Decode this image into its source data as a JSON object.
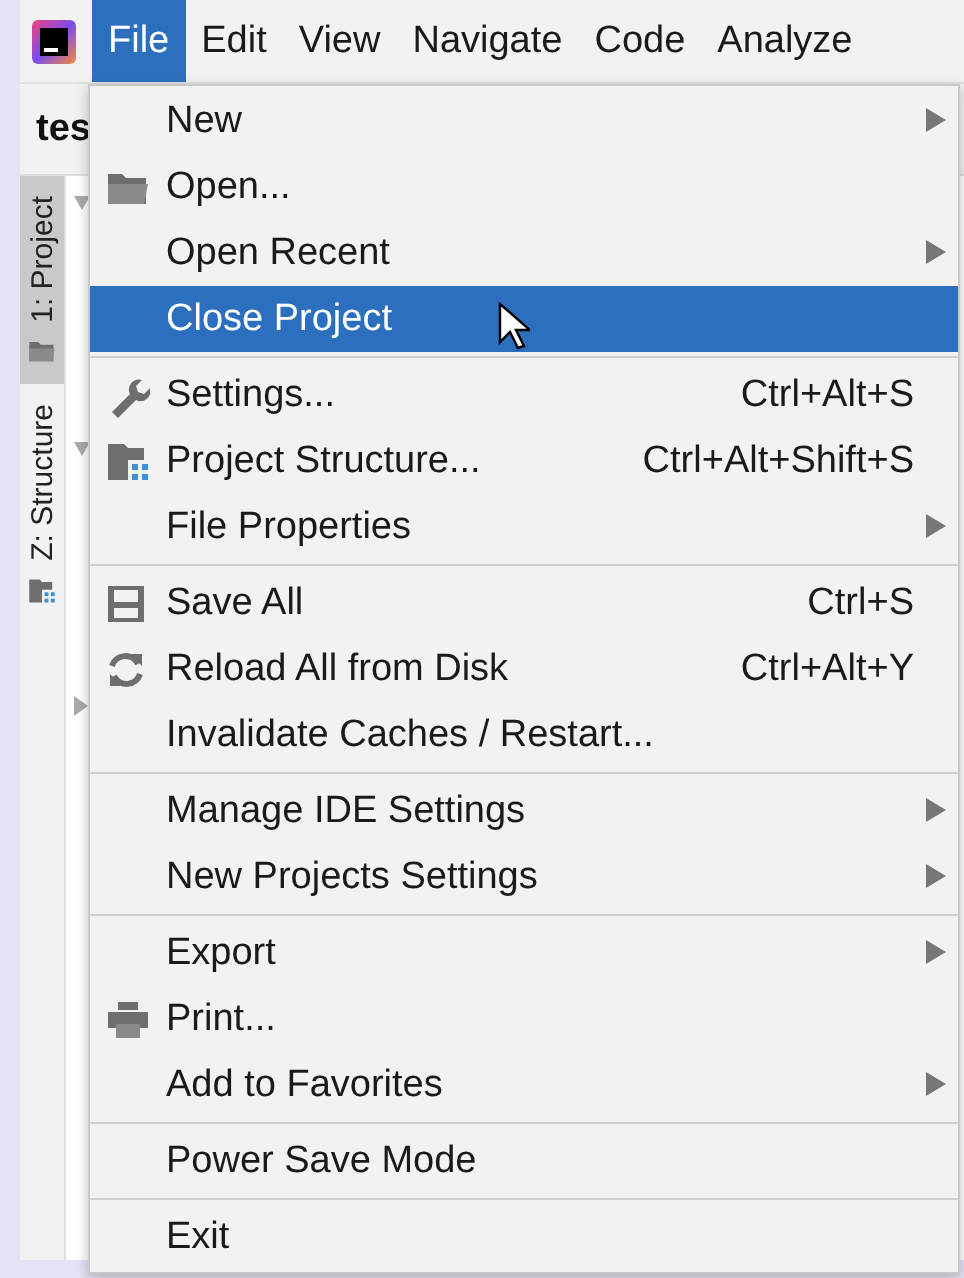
{
  "menubar": [
    {
      "label": "File",
      "selected": true
    },
    {
      "label": "Edit",
      "selected": false
    },
    {
      "label": "View",
      "selected": false
    },
    {
      "label": "Navigate",
      "selected": false
    },
    {
      "label": "Code",
      "selected": false
    },
    {
      "label": "Analyze",
      "selected": false
    }
  ],
  "project_title": "tes",
  "tool_windows": [
    {
      "label": "1: Project",
      "kind": "folder",
      "selected": true
    },
    {
      "label": "Z: Structure",
      "kind": "structure",
      "selected": false
    }
  ],
  "file_menu": [
    [
      {
        "label": "New",
        "kind": "plain",
        "submenu": true,
        "selected": false
      },
      {
        "label": "Open...",
        "kind": "folder",
        "selected": false
      },
      {
        "label": "Open Recent",
        "kind": "plain",
        "submenu": true,
        "selected": false
      },
      {
        "label": "Close Project",
        "kind": "plain",
        "pointer": true,
        "selected": true
      }
    ],
    [
      {
        "label": "Settings...",
        "kind": "wrench",
        "shortcut": "Ctrl+Alt+S",
        "selected": false
      },
      {
        "label": "Project Structure...",
        "kind": "structure",
        "shortcut": "Ctrl+Alt+Shift+S",
        "selected": false
      },
      {
        "label": "File Properties",
        "kind": "plain",
        "submenu": true,
        "selected": false
      }
    ],
    [
      {
        "label": "Save All",
        "kind": "save",
        "shortcut": "Ctrl+S",
        "selected": false
      },
      {
        "label": "Reload All from Disk",
        "kind": "reload",
        "shortcut": "Ctrl+Alt+Y",
        "selected": false
      },
      {
        "label": "Invalidate Caches / Restart...",
        "kind": "plain",
        "selected": false
      }
    ],
    [
      {
        "label": "Manage IDE Settings",
        "kind": "plain",
        "submenu": true,
        "selected": false
      },
      {
        "label": "New Projects Settings",
        "kind": "plain",
        "submenu": true,
        "selected": false
      }
    ],
    [
      {
        "label": "Export",
        "kind": "plain",
        "submenu": true,
        "selected": false
      },
      {
        "label": "Print...",
        "kind": "print",
        "selected": false
      },
      {
        "label": "Add to Favorites",
        "kind": "plain",
        "submenu": true,
        "selected": false
      }
    ],
    [
      {
        "label": "Power Save Mode",
        "kind": "plain",
        "selected": false
      }
    ],
    [
      {
        "label": "Exit",
        "kind": "plain",
        "selected": false
      }
    ]
  ]
}
